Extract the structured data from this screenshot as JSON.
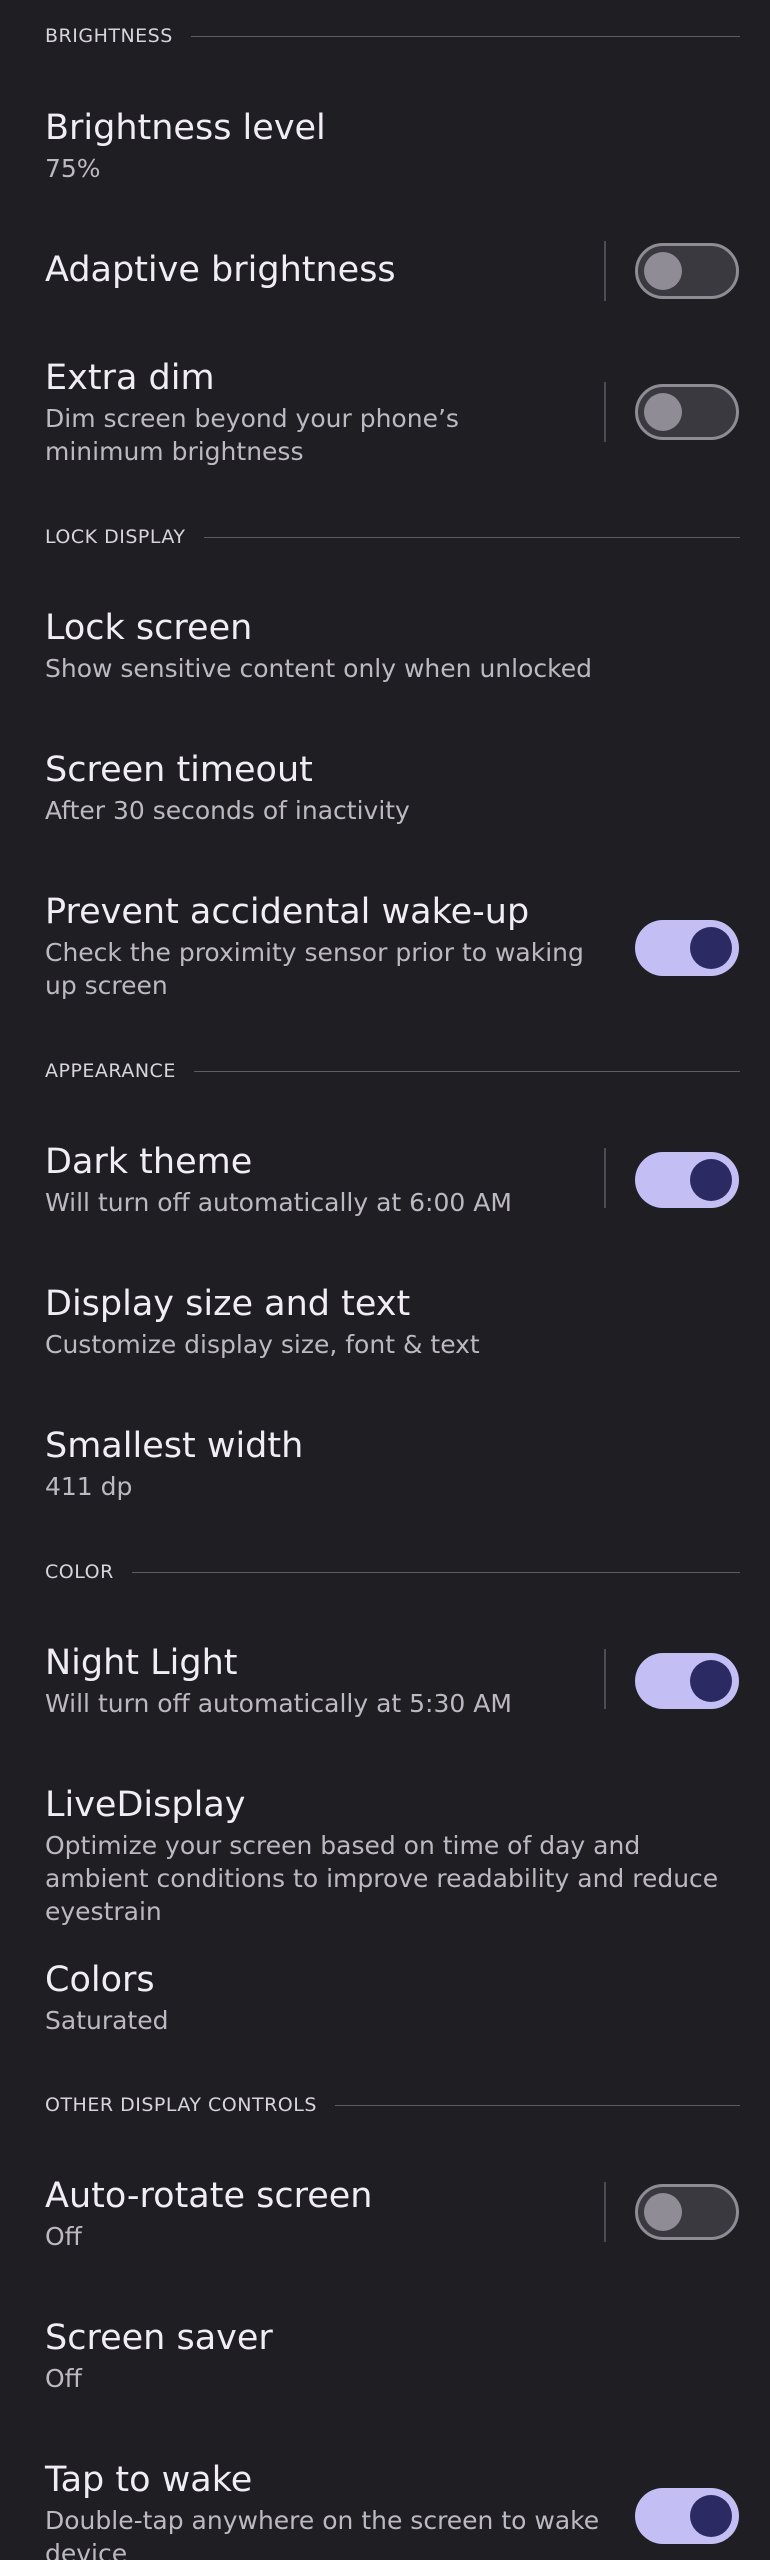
{
  "sections": {
    "brightness": "BRIGHTNESS",
    "lock_display": "LOCK DISPLAY",
    "appearance": "APPEARANCE",
    "color": "COLOR",
    "other_display_controls": "OTHER DISPLAY CONTROLS"
  },
  "items": {
    "brightness_level": {
      "title": "Brightness level",
      "summary": "75%"
    },
    "adaptive_brightness": {
      "title": "Adaptive brightness",
      "enabled": false
    },
    "extra_dim": {
      "title": "Extra dim",
      "summary": "Dim screen beyond your phone’s minimum brightness",
      "enabled": false
    },
    "lock_screen": {
      "title": "Lock screen",
      "summary": "Show sensitive content only when unlocked"
    },
    "screen_timeout": {
      "title": "Screen timeout",
      "summary": "After 30 seconds of inactivity"
    },
    "prevent_wakeup": {
      "title": "Prevent accidental wake-up",
      "summary": "Check the proximity sensor prior to waking up screen",
      "enabled": true
    },
    "dark_theme": {
      "title": "Dark theme",
      "summary": "Will turn off automatically at 6:00 AM",
      "enabled": true
    },
    "display_size": {
      "title": "Display size and text",
      "summary": "Customize display size, font & text"
    },
    "smallest_width": {
      "title": "Smallest width",
      "summary": "411 dp"
    },
    "night_light": {
      "title": "Night Light",
      "summary": "Will turn off automatically at 5:30 AM",
      "enabled": true
    },
    "livedisplay": {
      "title": "LiveDisplay",
      "summary": "Optimize your screen based on time of day and ambient conditions to improve readability and reduce eyestrain"
    },
    "colors": {
      "title": "Colors",
      "summary": "Saturated"
    },
    "auto_rotate": {
      "title": "Auto-rotate screen",
      "summary": "Off",
      "enabled": false
    },
    "screen_saver": {
      "title": "Screen saver",
      "summary": "Off"
    },
    "tap_to_wake": {
      "title": "Tap to wake",
      "summary": "Double-tap anywhere on the screen to wake device",
      "enabled": true
    }
  },
  "colors": {
    "background": "#1f1e23",
    "switch_on_track": "#c3bff5",
    "switch_on_thumb": "#2c2a63",
    "switch_off_track": "#3a393f",
    "switch_off_outline": "#8f8c95"
  }
}
